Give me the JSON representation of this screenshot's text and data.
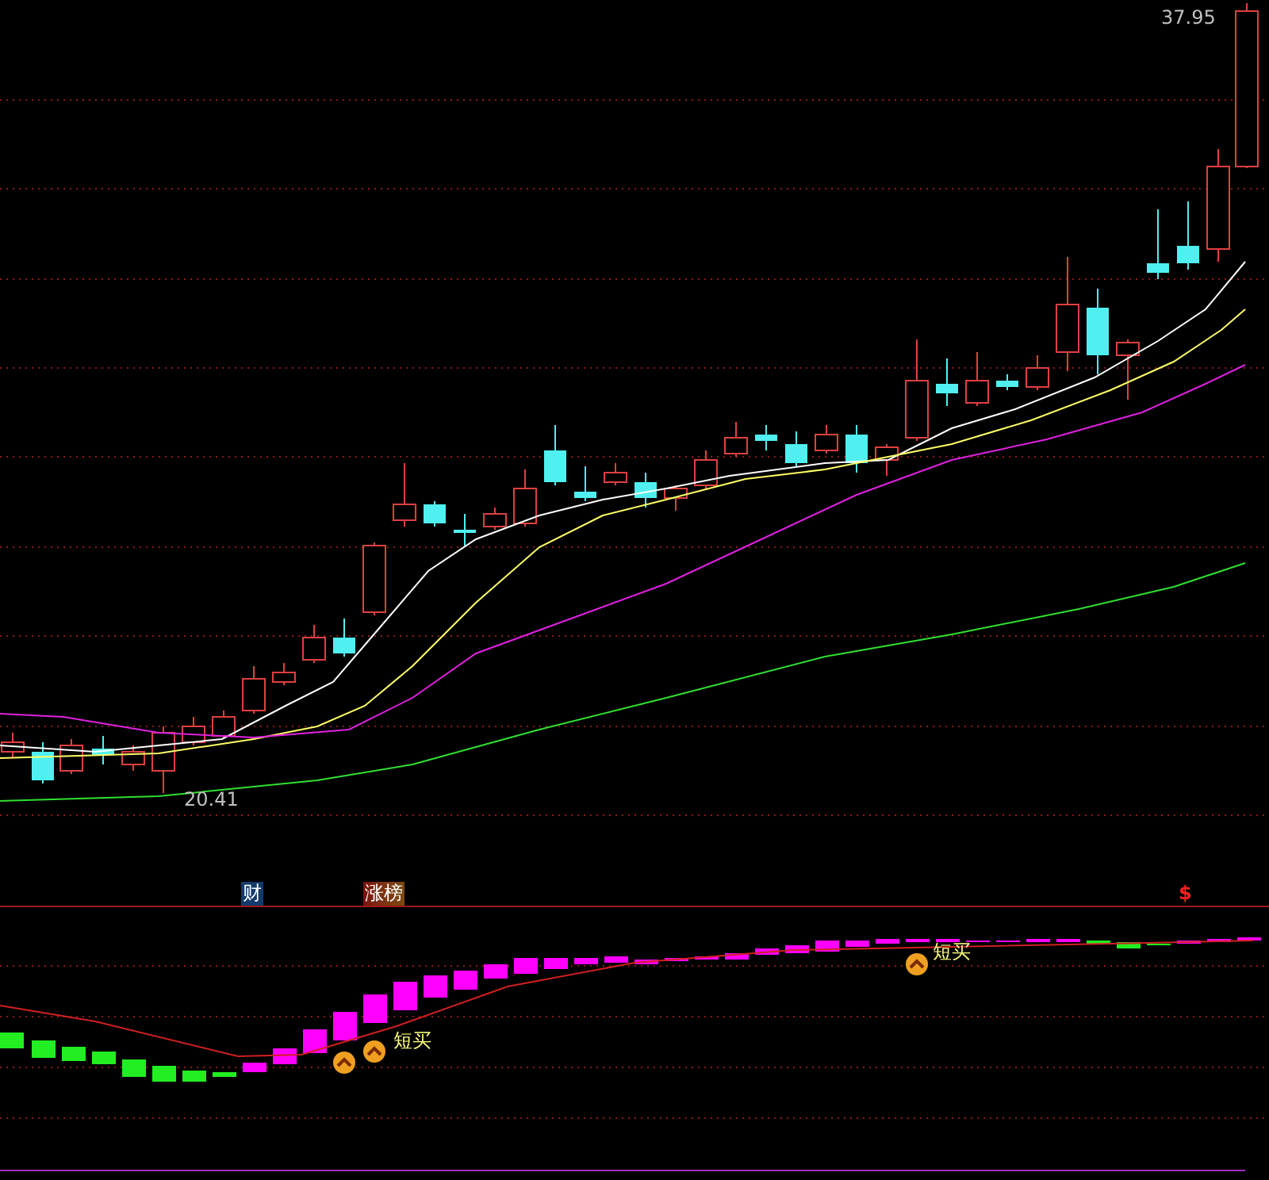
{
  "price_chart": {
    "high_label": "37.95",
    "low_label": "20.41"
  },
  "markers": [
    {
      "text": "财",
      "kind": "finance"
    },
    {
      "text": "涨榜",
      "kind": "gainers"
    },
    {
      "text": "$",
      "kind": "dollar"
    }
  ],
  "signals": [
    {
      "text": "短买"
    },
    {
      "text": "短买"
    }
  ]
}
